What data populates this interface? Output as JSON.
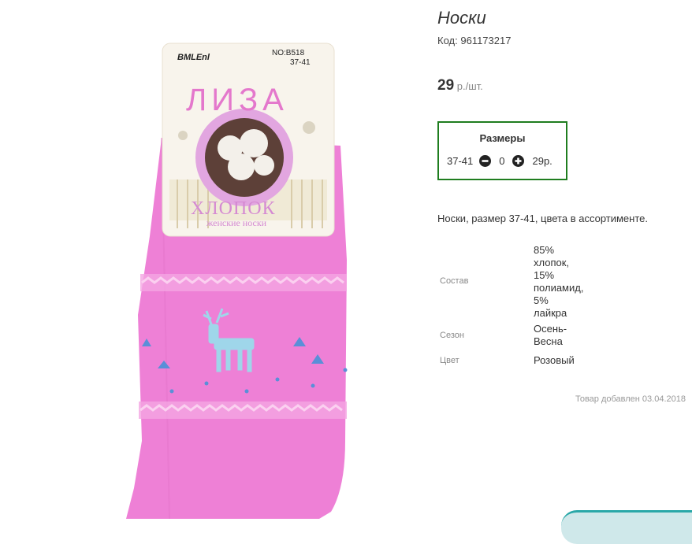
{
  "product": {
    "title": "Носки",
    "code_label": "Код:",
    "code": "961173217",
    "price_value": "29",
    "price_unit": "р./шт.",
    "description": "Носки, размер 37-41, цвета в ассортименте.",
    "added_text": "Товар добавлен 03.04.2018"
  },
  "sizes": {
    "title": "Размеры",
    "size": "37-41",
    "quantity": "0",
    "price": "29р."
  },
  "properties": [
    {
      "label": "Состав",
      "value_lines": [
        "85%",
        "хлопок,",
        "15%",
        "полиамид,",
        "5%",
        "лайкра"
      ]
    },
    {
      "label": "Сезон",
      "value_lines": [
        "Осень-",
        "Весна"
      ]
    },
    {
      "label": "Цвет",
      "value_lines": [
        "Розовый"
      ]
    }
  ],
  "label_card": {
    "brand": "BMLEnl",
    "model": "NO:B518",
    "size": "37-41",
    "name": "ЛИЗА",
    "material": "ХЛОПОК",
    "subtitle": "женские носки"
  },
  "colors": {
    "sock": "#ee80d6",
    "frame_border": "#1f7d1f"
  }
}
